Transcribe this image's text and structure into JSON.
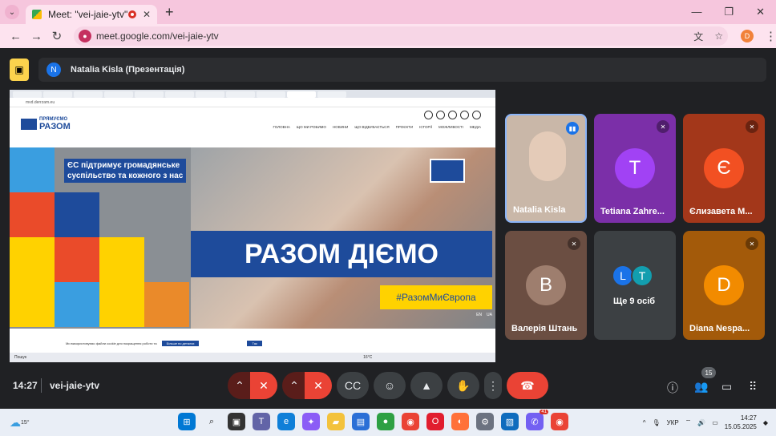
{
  "browser": {
    "tab_title": "Meet: \"vei-jaie-ytv\"",
    "url": "meet.google.com/vei-jaie-ytv",
    "profile_initial": "D"
  },
  "meet": {
    "presenter_initial": "N",
    "presenter_label": "Natalia Kisla (Презентація)",
    "time": "14:27",
    "meeting_code": "vei-jaie-ytv",
    "participants_count": "15"
  },
  "shared_screen": {
    "url": "mvd.derrzam.eu",
    "logo_top": "ПРЯМУЄМО",
    "logo_bottom": "РАЗОМ",
    "menu": [
      "ГОЛОВНА",
      "ЩО МИ РОБИМО",
      "НОВИНИ",
      "ЩО ВІДБУВАЄТЬСЯ",
      "ПРОЄКТИ",
      "ІСТОРІЇ",
      "МОЖЛИВОСТІ",
      "МЕДІА"
    ],
    "slogan_line1": "ЄС підтримує громадянське",
    "slogan_line2": "суспільство та кожного з нас",
    "headline": "РАЗОМ ДІЄМО",
    "hashtag": "#РазомМиЄвропа",
    "lang_en": "EN",
    "lang_ua": "UA",
    "cookie_text": "Ми використовуємо файли cookie для покращення роботи та",
    "cookie_settings": "Більше по деталях",
    "cookie_ok": "Так",
    "taskbar_text": "Пошук",
    "temp": "16°C"
  },
  "participants": [
    {
      "name": "Natalia Kisla",
      "initial": "",
      "color": "#c9b7a8"
    },
    {
      "name": "Tetiana Zahre...",
      "initial": "T",
      "color": "#a142f4"
    },
    {
      "name": "Єлизавета М...",
      "initial": "Є",
      "color": "#f25022"
    },
    {
      "name": "Валерія Штань",
      "initial": "В",
      "color": "#9e7e6e"
    },
    {
      "name": "Ще 9 осіб",
      "initial": "",
      "color": "#3c4043"
    },
    {
      "name": "Diana Nespa...",
      "initial": "D",
      "color": "#f28b00"
    }
  ],
  "more_avatars": [
    "L",
    "T"
  ],
  "windows": {
    "weather": "15°",
    "lang": "УКР",
    "time": "14:27",
    "date": "15.05.2025",
    "notif": "41"
  }
}
